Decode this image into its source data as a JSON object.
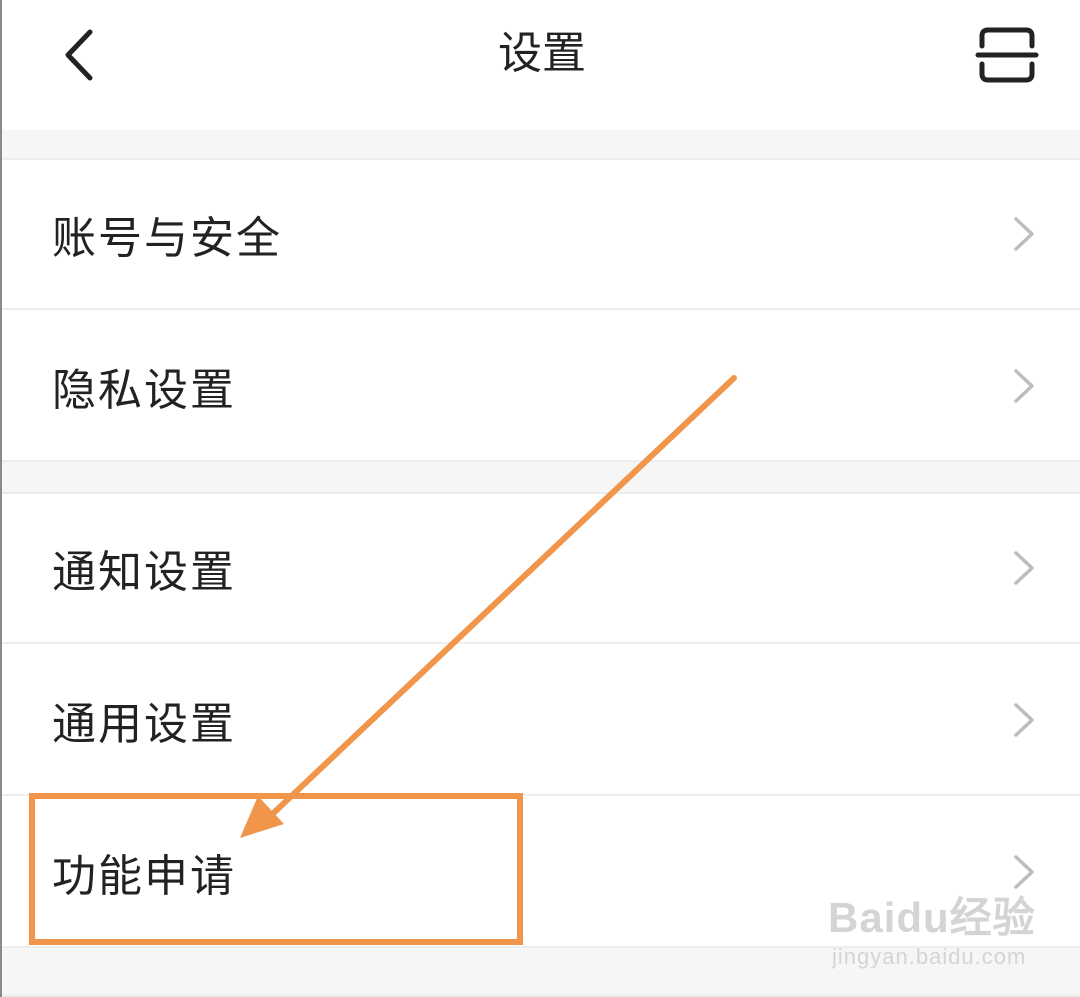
{
  "header": {
    "title": "设置",
    "back_icon": "chevron-left-icon",
    "scan_icon": "scan-icon"
  },
  "settings": {
    "groups": [
      {
        "items": [
          {
            "label": "账号与安全"
          },
          {
            "label": "隐私设置"
          }
        ]
      },
      {
        "items": [
          {
            "label": "通知设置"
          },
          {
            "label": "通用设置"
          },
          {
            "label": "功能申请"
          }
        ]
      }
    ]
  },
  "annotation": {
    "color": "#F0954A",
    "highlighted_item": "功能申请"
  },
  "watermark": {
    "logo_text": "Baidu经验",
    "url": "jingyan.baidu.com"
  },
  "colors": {
    "text": "#222222",
    "chevron": "#BDBDBD",
    "separator": "#F6F6F6"
  }
}
